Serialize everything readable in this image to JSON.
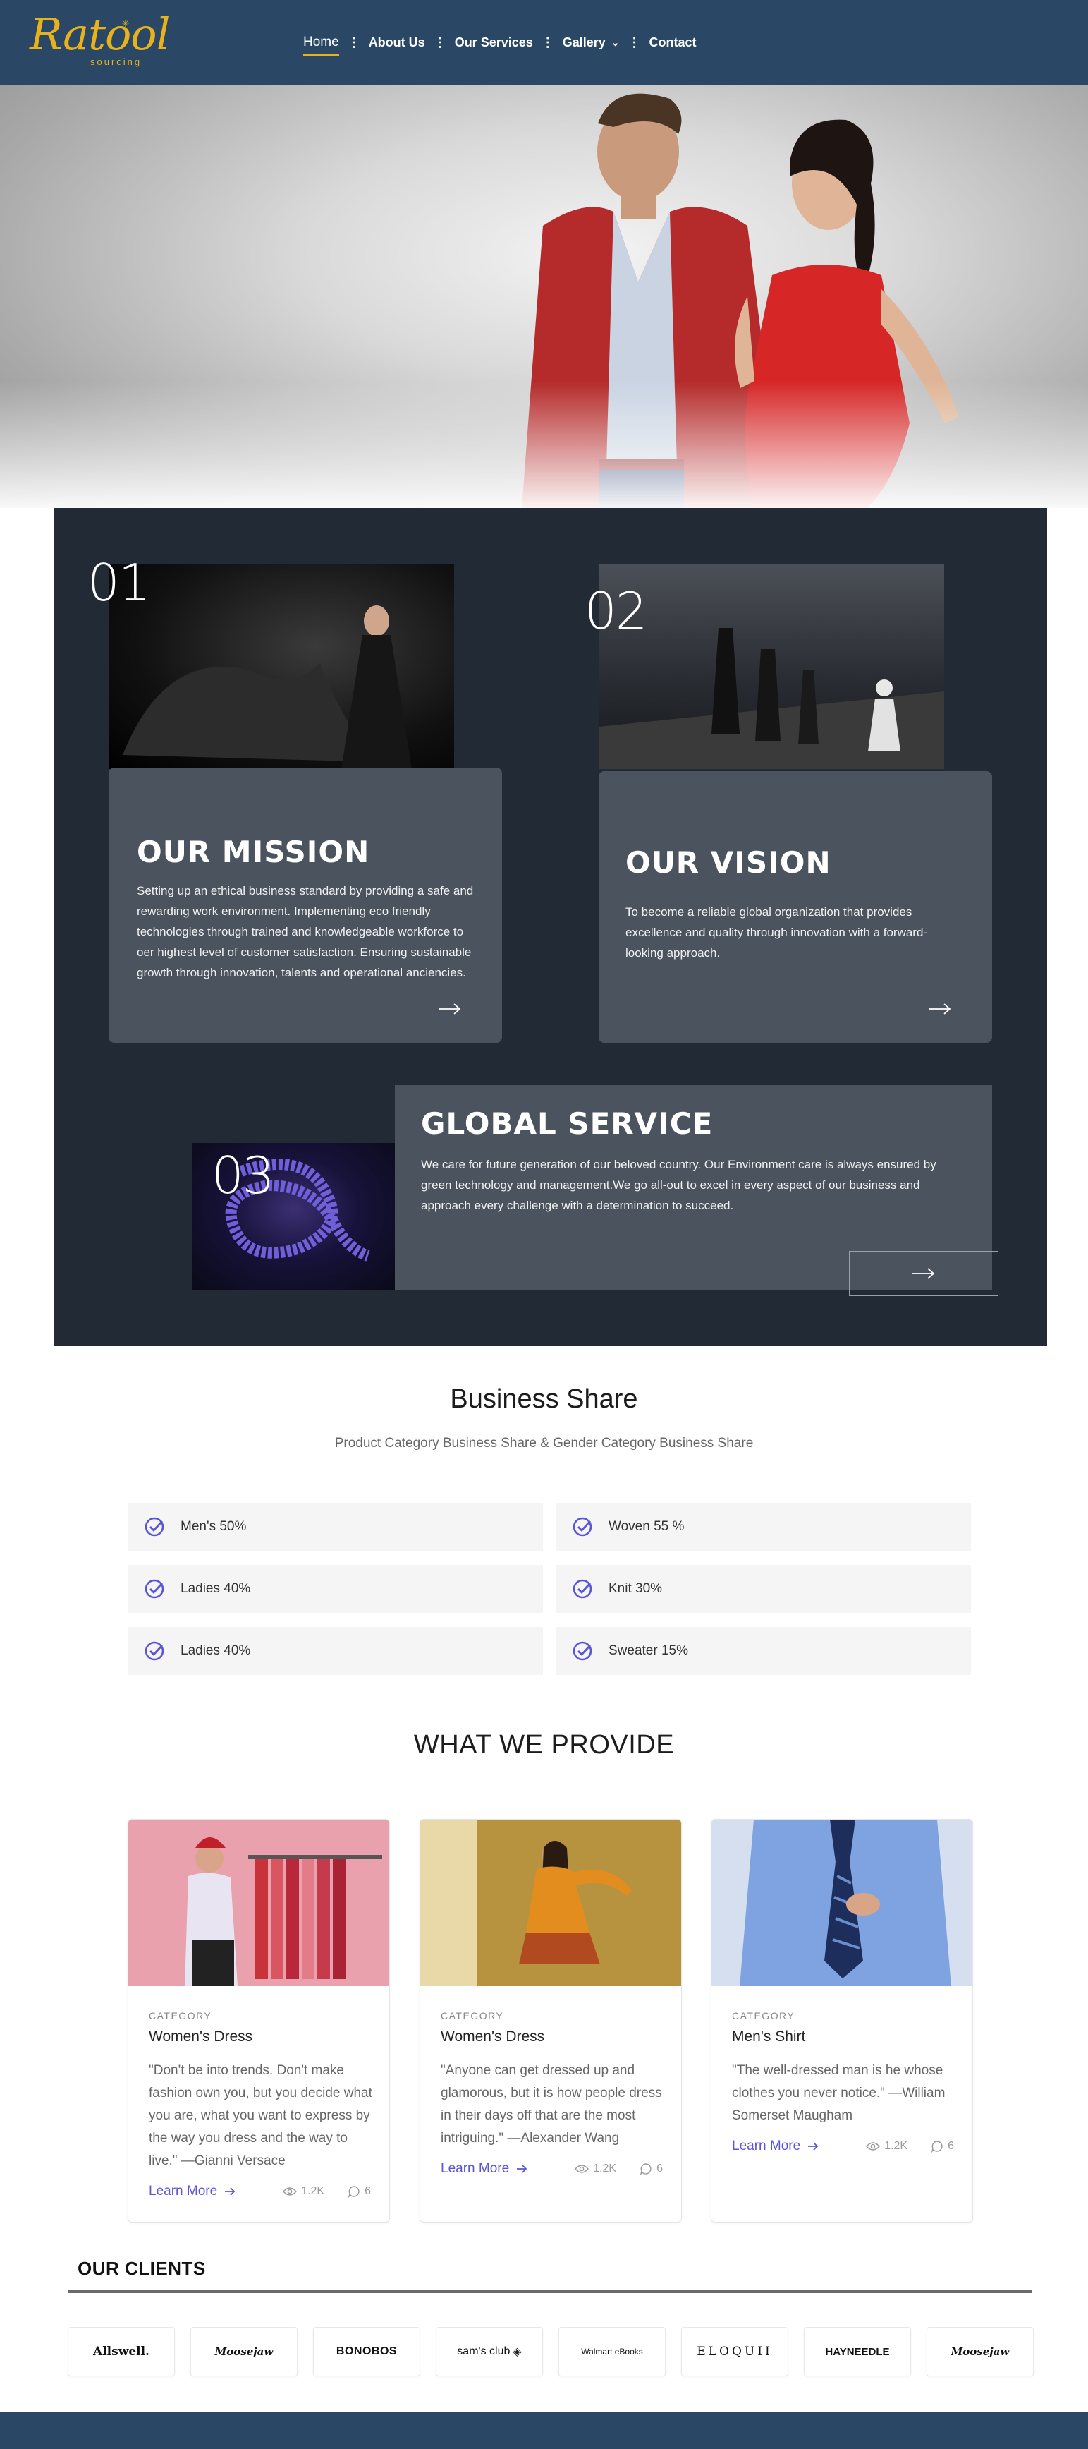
{
  "brand": {
    "name": "Ratool",
    "tagline": "sourcing"
  },
  "nav": {
    "items": [
      {
        "label": "Home",
        "active": true
      },
      {
        "label": "About Us"
      },
      {
        "label": "Our Services"
      },
      {
        "label": "Gallery",
        "has_dropdown": true
      },
      {
        "label": "Contact"
      }
    ]
  },
  "mission": {
    "number": "01",
    "title": "OUR MISSION",
    "text": "Setting up an ethical business standard by providing a safe and rewarding work environment. Implementing eco friendly technologies through trained and knowledgeable workforce to oer highest level of customer satisfaction. Ensuring sustainable growth through innovation, talents and operational anciencies."
  },
  "vision": {
    "number": "02",
    "title": "OUR VISION",
    "text": "To become a reliable global organization that provides excellence and quality through innovation with a forward-looking approach."
  },
  "global": {
    "number": "03",
    "title": "GLOBAL SERVICE",
    "text": "We care for future generation of our beloved country. Our Environment care is always ensured by green technology and management.We go all-out to excel in every aspect of our business and approach every challenge with a determination to succeed."
  },
  "business_share": {
    "title": "Business Share",
    "subtitle": "Product Category Business Share & Gender Category Business Share",
    "items": [
      "Men's 50%",
      "Woven 55 %",
      "Ladies 40%",
      "Knit 30%",
      "Ladies 40%",
      "Sweater 15%"
    ]
  },
  "provide": {
    "title": "WHAT WE PROVIDE",
    "cards": [
      {
        "category": "CATEGORY",
        "name": "Women's Dress",
        "quote": "\"Don't be into trends. Don't make fashion own you, but you decide what you are, what you want to express by the way you dress and the way to live.\" —Gianni Versace",
        "learn_more": "Learn More",
        "views": "1.2K",
        "comments": "6"
      },
      {
        "category": "CATEGORY",
        "name": "Women's Dress",
        "quote": "\"Anyone can get dressed up and glamorous, but it is how people dress in their days off that are the most intriguing.\" —Alexander Wang",
        "learn_more": "Learn More",
        "views": "1.2K",
        "comments": "6"
      },
      {
        "category": "CATEGORY",
        "name": "Men's Shirt",
        "quote": "\"The well-dressed man is he whose clothes you never notice.\" —William Somerset Maugham",
        "learn_more": "Learn More",
        "views": "1.2K",
        "comments": "6"
      }
    ]
  },
  "clients": {
    "title": "OUR CLIENTS",
    "logos": [
      "Allswell.",
      "Moosejaw",
      "BONOBOS",
      "sam's club",
      "Walmart eBooks",
      "ELOQUII",
      "HAYNEEDLE",
      "Moosejaw"
    ]
  },
  "colors": {
    "nav_bg": "#2a4766",
    "brand_gold": "#e8b21d",
    "dark_section": "#222b35",
    "card_bg": "#4a535e",
    "accent": "#5a55d6"
  }
}
